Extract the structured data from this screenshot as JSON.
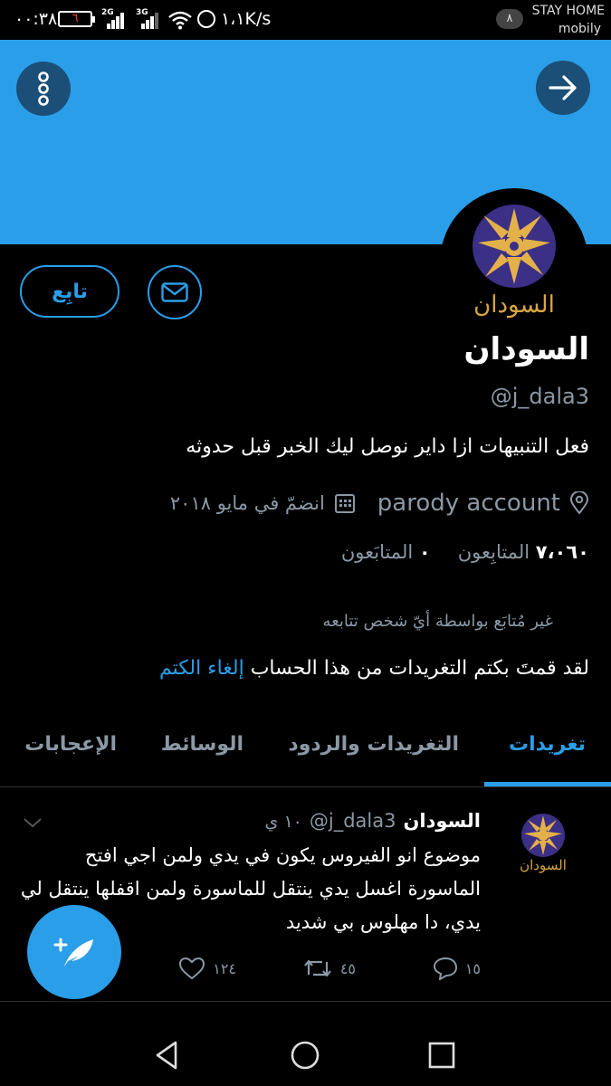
{
  "status_bar": {
    "time": "٠٠:٣٨",
    "battery_level": "٦",
    "net_2g": "2G",
    "net_3g": "3G",
    "speed": "١،١K/s",
    "notification_count": "٨",
    "stay_home": "STAY HOME",
    "carrier": "mobily"
  },
  "colors": {
    "accent": "#2a9ee8",
    "banner": "#2a9ee8",
    "background": "#000000",
    "secondary_text": "#8b98a5",
    "logo_gold": "#d9a441",
    "logo_purple": "#3b2f86"
  },
  "header": {
    "more_icon": "more-vertical-icon",
    "back_icon": "arrow-right-icon"
  },
  "profile": {
    "avatar_text": "السودان",
    "follow_label": "تابِع",
    "name": "السودان",
    "handle": "@j_dala3",
    "bio": "فعل التنبيهات ازا داير نوصل ليك الخبر قبل حدوثه",
    "location": "parody account",
    "joined": "انضمّ في مايو ٢٠١٨",
    "followers_count": "٠",
    "followers_label": "المتابَعون",
    "following_count": "٧،٠٦٠",
    "following_label": "المتابِعون",
    "not_followed": "غير مُتابَع بواسطة أيّ شخص تتابعه",
    "muted_text": "لقد قمتَ بكتم التغريدات من هذا الحساب",
    "unmute_label": "إلغاء الكتم"
  },
  "tabs": [
    {
      "label": "تغريدات",
      "active": true
    },
    {
      "label": "التغريدات والردود",
      "active": false
    },
    {
      "label": "الوسائط",
      "active": false
    },
    {
      "label": "الإعجابات",
      "active": false
    }
  ],
  "tweet": {
    "avatar_text": "السودان",
    "name": "السودان",
    "handle": "@j_dala3",
    "time": "١٠ ي",
    "text": "موضوع انو الفيروس يكون في يدي ولمن اجي افتح الماسورة اغسل يدي ينتقل للماسورة ولمن اقفلها ينتقل لي يدي، دا مهلوس بي شديد",
    "replies": "١٥",
    "retweets": "٤٥",
    "likes": "١٢٤"
  }
}
